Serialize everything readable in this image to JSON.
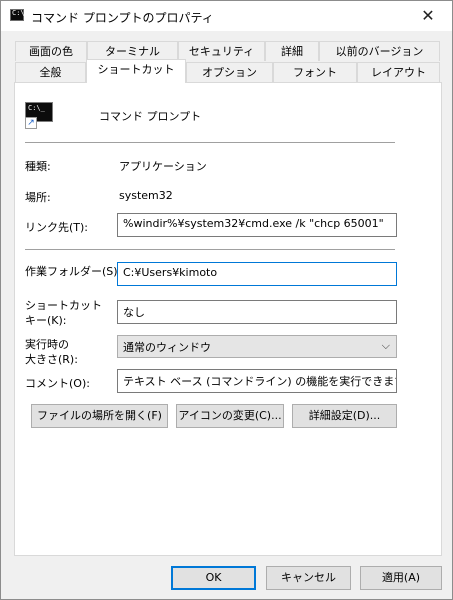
{
  "window": {
    "title": "コマンド プロンプトのプロパティ",
    "close_glyph": "✕"
  },
  "tabs_row1": [
    "画面の色",
    "ターミナル",
    "セキュリティ",
    "詳細",
    "以前のバージョン"
  ],
  "tabs_row2": [
    "全般",
    "ショートカット",
    "オプション",
    "フォント",
    "レイアウト"
  ],
  "active_tab": "ショートカット",
  "shortcut": {
    "name": "コマンド プロンプト",
    "icon": "cmd-console-icon",
    "type_label": "種類:",
    "type_value": "アプリケーション",
    "location_label": "場所:",
    "location_value": "system32",
    "target_label": "リンク先(T):",
    "target_value": "%windir%¥system32¥cmd.exe /k \"chcp 65001\"",
    "workdir_label": "作業フォルダー(S):",
    "workdir_value": "C:¥Users¥kimoto",
    "hotkey_label_1": "ショートカット",
    "hotkey_label_2": "キー(K):",
    "hotkey_value": "なし",
    "run_label_1": "実行時の",
    "run_label_2": "大きさ(R):",
    "run_value": "通常のウィンドウ",
    "comment_label": "コメント(O):",
    "comment_value": "テキスト ベース (コマンドライン) の機能を実行できます。",
    "open_location_button": "ファイルの場所を開く(F)",
    "change_icon_button": "アイコンの変更(C)...",
    "advanced_button": "詳細設定(D)..."
  },
  "footer": {
    "ok": "OK",
    "cancel": "キャンセル",
    "apply": "適用(A)"
  },
  "colors": {
    "accent": "#0078d7",
    "panel": "#ffffff",
    "dialog": "#f0f0f0"
  }
}
